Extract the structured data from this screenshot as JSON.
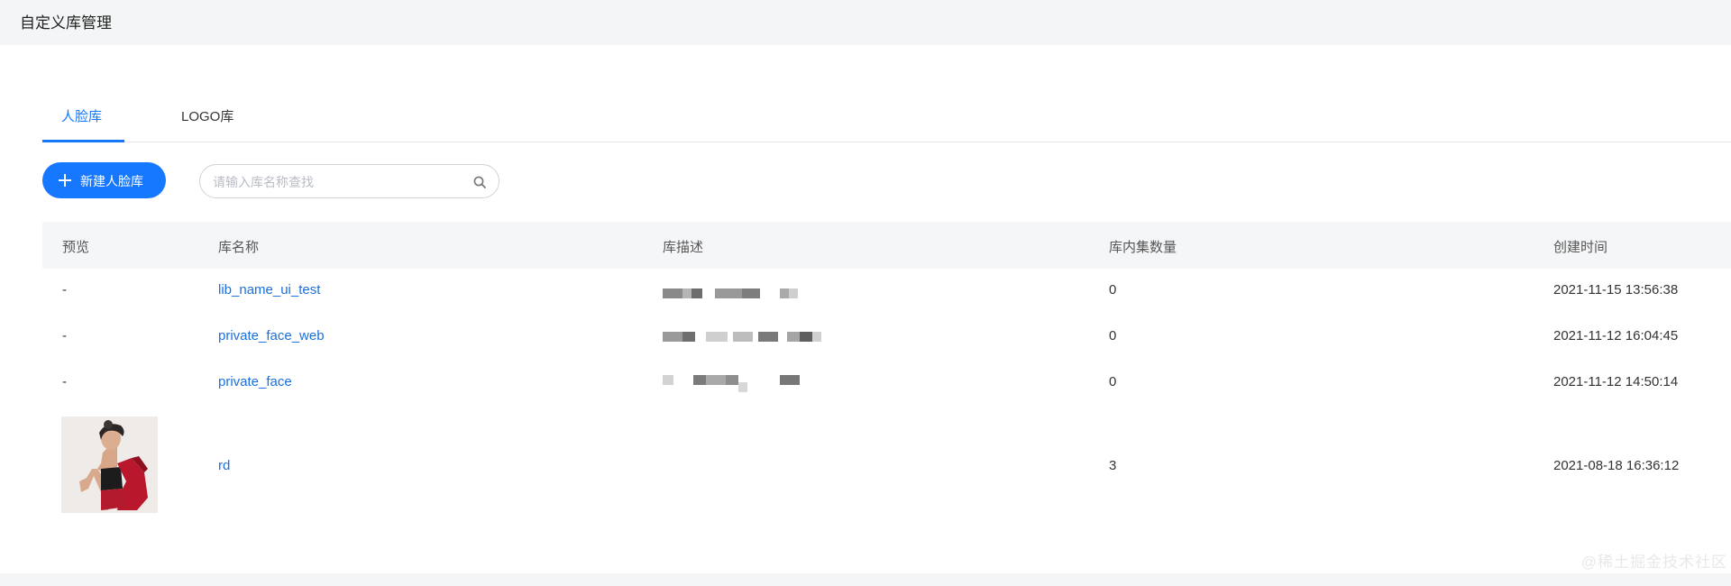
{
  "page": {
    "title": "自定义库管理"
  },
  "tabs": [
    {
      "label": "人脸库",
      "active": true
    },
    {
      "label": "LOGO库",
      "active": false
    }
  ],
  "toolbar": {
    "new_button_label": "新建人脸库",
    "search_placeholder": "请输入库名称查找",
    "search_value": ""
  },
  "table": {
    "columns": [
      "预览",
      "库名称",
      "库描述",
      "库内集数量",
      "创建时间"
    ],
    "rows": [
      {
        "preview": "-",
        "name": "lib_name_ui_test",
        "description": "",
        "count": "0",
        "created": "2021-11-15 13:56:38"
      },
      {
        "preview": "-",
        "name": "private_face_web",
        "description": "",
        "count": "0",
        "created": "2021-11-12 16:04:45"
      },
      {
        "preview": "-",
        "name": "private_face",
        "description": "",
        "count": "0",
        "created": "2021-11-12 14:50:14"
      },
      {
        "preview": "image",
        "name": "rd",
        "description": "",
        "count": "3",
        "created": "2021-08-18 16:36:12"
      }
    ]
  },
  "watermark": "@稀土掘金技术社区",
  "colors": {
    "accent": "#1677ff",
    "link": "#1a6fde",
    "header_bg": "#f5f6f8",
    "page_bg": "#f4f5f7"
  }
}
